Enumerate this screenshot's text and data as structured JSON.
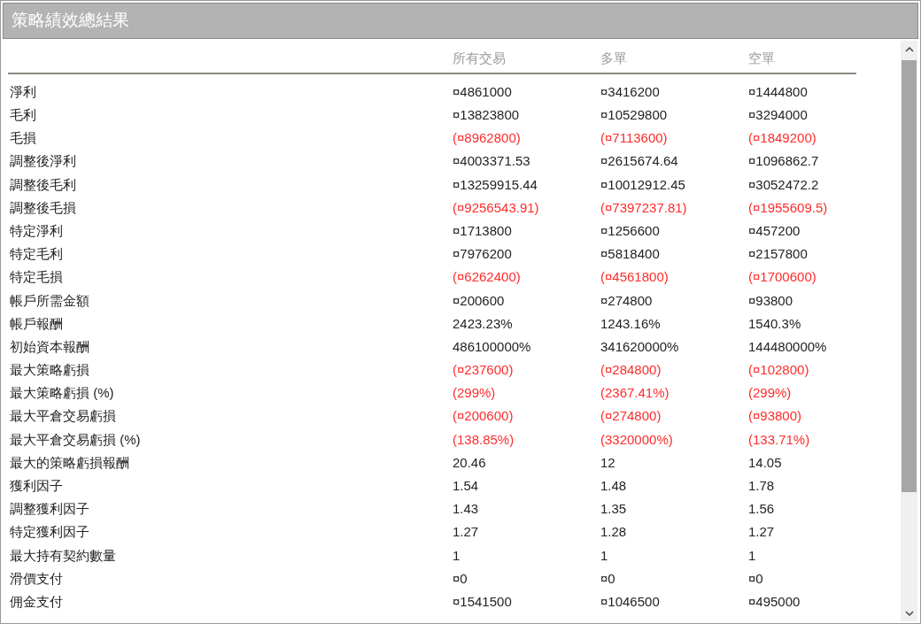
{
  "window": {
    "title": "策略績效總結果"
  },
  "table": {
    "columns": [
      "所有交易",
      "多單",
      "空單"
    ],
    "rows": [
      {
        "label": "淨利",
        "values": [
          "¤4861000",
          "¤3416200",
          "¤1444800"
        ],
        "negative": false
      },
      {
        "label": "毛利",
        "values": [
          "¤13823800",
          "¤10529800",
          "¤3294000"
        ],
        "negative": false
      },
      {
        "label": "毛損",
        "values": [
          "(¤8962800)",
          "(¤7113600)",
          "(¤1849200)"
        ],
        "negative": true
      },
      {
        "label": "調整後淨利",
        "values": [
          "¤4003371.53",
          "¤2615674.64",
          "¤1096862.7"
        ],
        "negative": false
      },
      {
        "label": "調整後毛利",
        "values": [
          "¤13259915.44",
          "¤10012912.45",
          "¤3052472.2"
        ],
        "negative": false
      },
      {
        "label": "調整後毛損",
        "values": [
          "(¤9256543.91)",
          "(¤7397237.81)",
          "(¤1955609.5)"
        ],
        "negative": true
      },
      {
        "label": "特定淨利",
        "values": [
          "¤1713800",
          "¤1256600",
          "¤457200"
        ],
        "negative": false
      },
      {
        "label": "特定毛利",
        "values": [
          "¤7976200",
          "¤5818400",
          "¤2157800"
        ],
        "negative": false
      },
      {
        "label": "特定毛損",
        "values": [
          "(¤6262400)",
          "(¤4561800)",
          "(¤1700600)"
        ],
        "negative": true
      },
      {
        "label": "帳戶所需金額",
        "values": [
          "¤200600",
          "¤274800",
          "¤93800"
        ],
        "negative": false
      },
      {
        "label": "帳戶報酬",
        "values": [
          "2423.23%",
          "1243.16%",
          "1540.3%"
        ],
        "negative": false
      },
      {
        "label": "初始資本報酬",
        "values": [
          "486100000%",
          "341620000%",
          "144480000%"
        ],
        "negative": false
      },
      {
        "label": "最大策略虧損",
        "values": [
          "(¤237600)",
          "(¤284800)",
          "(¤102800)"
        ],
        "negative": true
      },
      {
        "label": "最大策略虧損 (%)",
        "values": [
          "(299%)",
          "(2367.41%)",
          "(299%)"
        ],
        "negative": true
      },
      {
        "label": "最大平倉交易虧損",
        "values": [
          "(¤200600)",
          "(¤274800)",
          "(¤93800)"
        ],
        "negative": true
      },
      {
        "label": "最大平倉交易虧損 (%)",
        "values": [
          "(138.85%)",
          "(3320000%)",
          "(133.71%)"
        ],
        "negative": true
      },
      {
        "label": "最大的策略虧損報酬",
        "values": [
          "20.46",
          "12",
          "14.05"
        ],
        "negative": false
      },
      {
        "label": "獲利因子",
        "values": [
          "1.54",
          "1.48",
          "1.78"
        ],
        "negative": false
      },
      {
        "label": "調整獲利因子",
        "values": [
          "1.43",
          "1.35",
          "1.56"
        ],
        "negative": false
      },
      {
        "label": "特定獲利因子",
        "values": [
          "1.27",
          "1.28",
          "1.27"
        ],
        "negative": false
      },
      {
        "label": "最大持有契約數量",
        "values": [
          "1",
          "1",
          "1"
        ],
        "negative": false
      },
      {
        "label": "滑價支付",
        "values": [
          "¤0",
          "¤0",
          "¤0"
        ],
        "negative": false
      },
      {
        "label": "佣金支付",
        "values": [
          "¤1541500",
          "¤1046500",
          "¤495000"
        ],
        "negative": false
      }
    ]
  }
}
